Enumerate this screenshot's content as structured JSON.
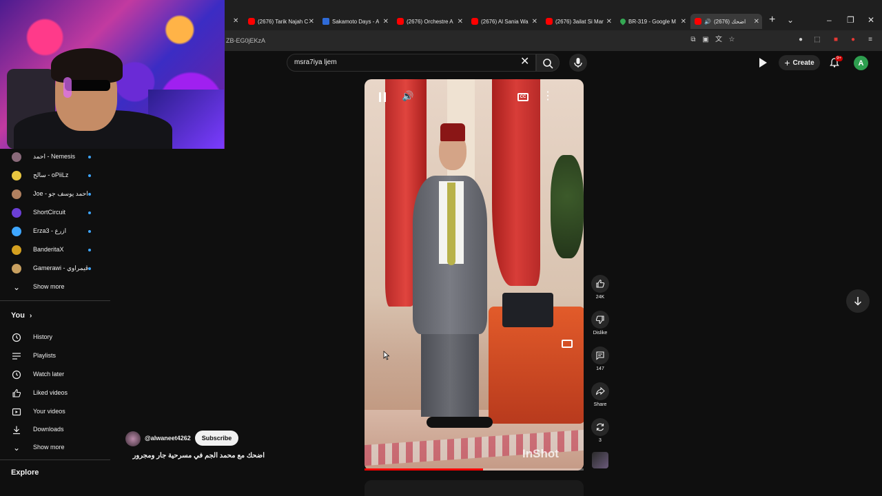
{
  "tabs": [
    {
      "title": "(2676) Tarik Najah C",
      "favicon": "youtube-icon"
    },
    {
      "title": "Sakamoto Days - A",
      "favicon": "anime-site-icon"
    },
    {
      "title": "(2676) Orchestre A",
      "favicon": "youtube-icon"
    },
    {
      "title": "(2676) Al Sania Wa",
      "favicon": "youtube-icon"
    },
    {
      "title": "(2676) 3ailat Si Mar",
      "favicon": "youtube-icon"
    },
    {
      "title": "BR-319 - Google M",
      "favicon": "google-maps-icon"
    },
    {
      "title": "(2676) اضحك",
      "favicon": "youtube-icon",
      "active": true
    }
  ],
  "address": {
    "url_fragment": "ZB-EG0jEKzA"
  },
  "search": {
    "query": "msra7iya ljem"
  },
  "header": {
    "create_label": "Create",
    "notif_count": "9+",
    "avatar_letter": "A"
  },
  "sidebar": {
    "subscriptions": [
      {
        "name": "احمد - Nemesis",
        "avatar_color": "#8a6a7a"
      },
      {
        "name": "سالح - oPiiLz",
        "avatar_color": "#e8c640"
      },
      {
        "name": "Joe - احمد يوسف جو",
        "avatar_color": "#b08060"
      },
      {
        "name": "ShortCircuit",
        "avatar_color": "#6b3fd6"
      },
      {
        "name": "Erza3 - ازرع",
        "avatar_color": "#3ea6ff"
      },
      {
        "name": "BanderitaX",
        "avatar_color": "#d4a020"
      },
      {
        "name": "Gamerawi - ڨيمراوي",
        "avatar_color": "#c8a060"
      }
    ],
    "show_more_1": "Show more",
    "you_heading": "You",
    "you_items": [
      {
        "label": "History",
        "icon": "history-icon"
      },
      {
        "label": "Playlists",
        "icon": "playlists-icon"
      },
      {
        "label": "Watch later",
        "icon": "watch-later-icon"
      },
      {
        "label": "Liked videos",
        "icon": "liked-videos-icon"
      },
      {
        "label": "Your videos",
        "icon": "your-videos-icon"
      },
      {
        "label": "Downloads",
        "icon": "downloads-icon"
      }
    ],
    "show_more_2": "Show more",
    "explore_heading": "Explore"
  },
  "short": {
    "watermark": "InShot",
    "progress": 0.54
  },
  "actions": {
    "like_count": "24K",
    "dislike_label": "Dislike",
    "comment_count": "147",
    "share_label": "Share",
    "remix_count": "3"
  },
  "channel": {
    "handle": "@alwaneet4262",
    "subscribe_label": "Subscribe",
    "title": "اضحك مع محمد الجم في مسرحية جار ومجرور"
  }
}
